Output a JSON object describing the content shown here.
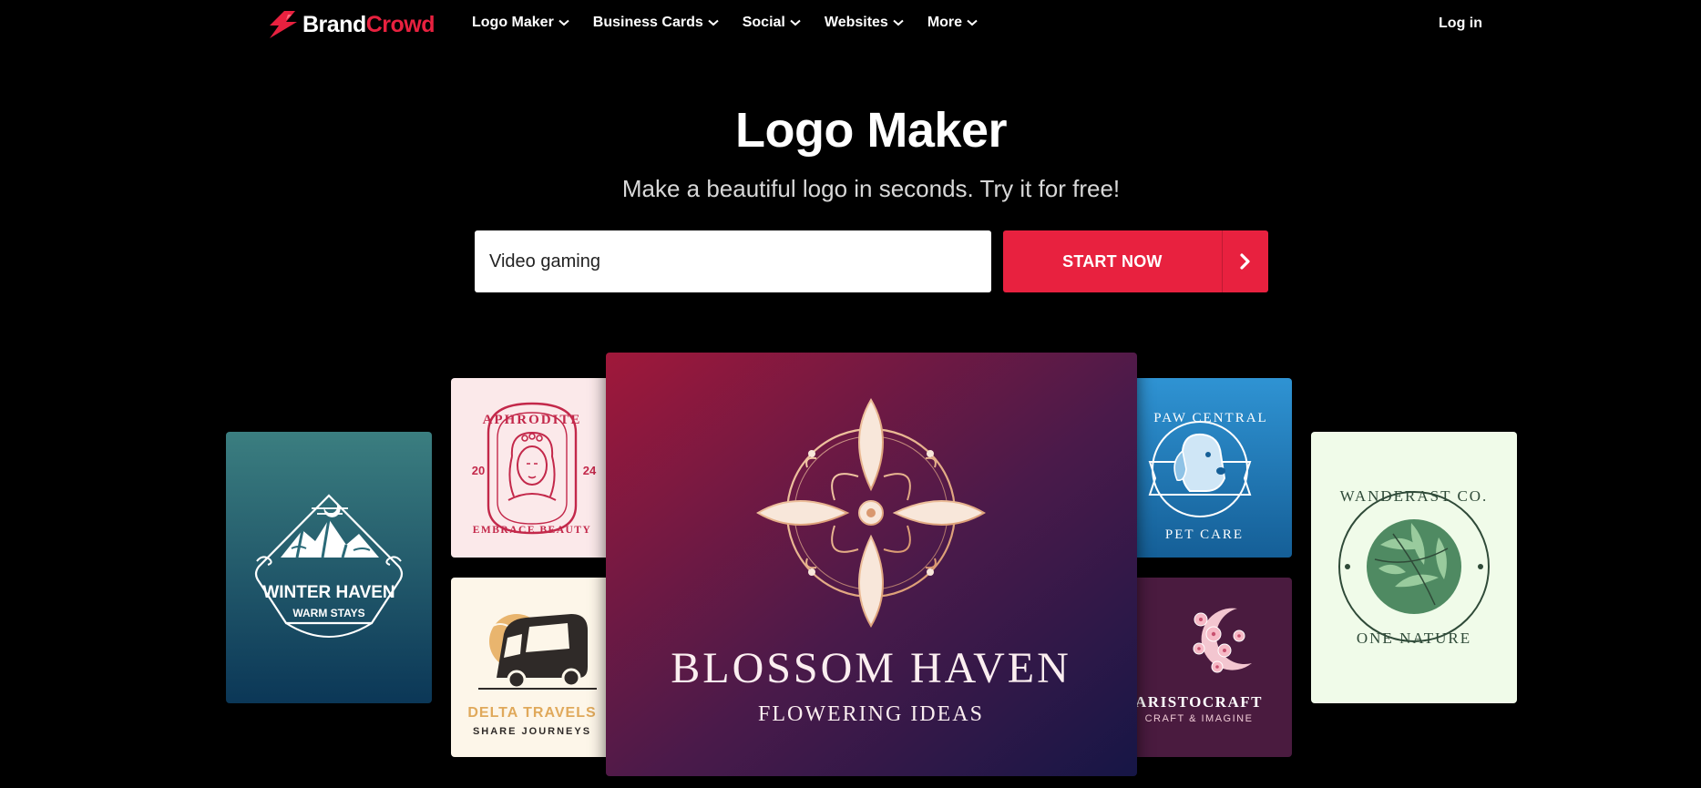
{
  "brand": {
    "name_part1": "Brand",
    "name_part2": "Crowd",
    "accent": "#e8213f"
  },
  "nav": {
    "items": [
      {
        "label": "Logo Maker"
      },
      {
        "label": "Business Cards"
      },
      {
        "label": "Social"
      },
      {
        "label": "Websites"
      },
      {
        "label": "More"
      }
    ],
    "login": "Log in"
  },
  "hero": {
    "title": "Logo Maker",
    "subtitle": "Make a beautiful logo in seconds. Try it for free!",
    "search_value": "Video gaming",
    "cta_label": "START NOW",
    "cta_icon": "chevron-right-icon"
  },
  "logos": {
    "winter_haven": {
      "name": "WINTER HAVEN",
      "tagline": "WARM STAYS"
    },
    "aphrodite": {
      "name": "APHRODITE",
      "tagline": "EMBRACE BEAUTY",
      "year_left": "20",
      "year_right": "24"
    },
    "delta_travels": {
      "name": "DELTA TRAVELS",
      "tagline": "SHARE JOURNEYS"
    },
    "blossom_haven": {
      "name": "BLOSSOM HAVEN",
      "tagline": "FLOWERING IDEAS"
    },
    "paw_central": {
      "name": "PAW CENTRAL",
      "tagline": "PET CARE"
    },
    "aristocraft": {
      "name": "ARISTOCRAFT",
      "tagline": "CRAFT & IMAGINE"
    },
    "wanderast": {
      "name": "WANDERAST CO.",
      "tagline": "ONE NATURE"
    }
  }
}
